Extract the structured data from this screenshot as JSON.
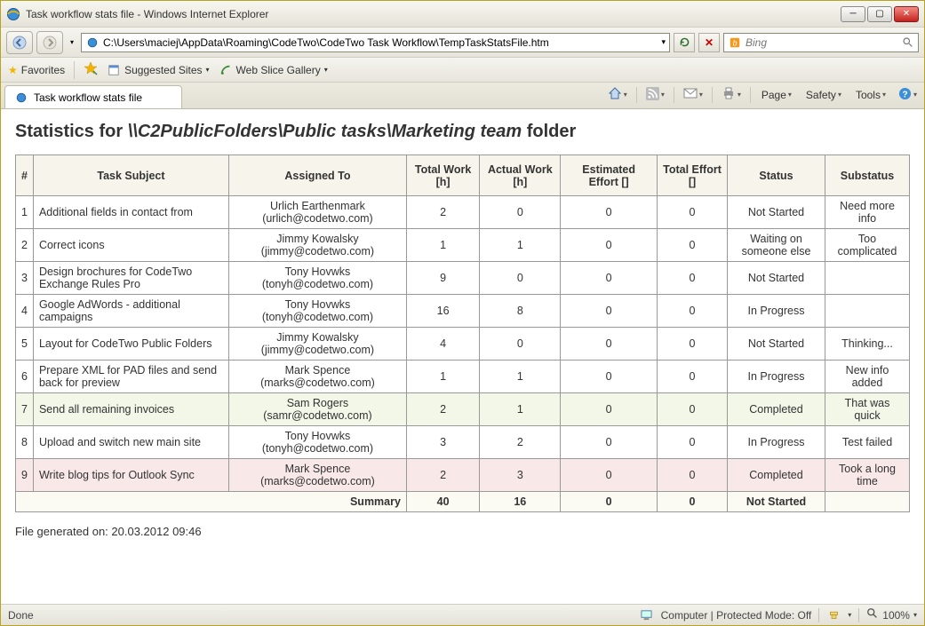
{
  "window": {
    "title": "Task workflow stats file - Windows Internet Explorer"
  },
  "nav": {
    "url": "C:\\Users\\maciej\\AppData\\Roaming\\CodeTwo\\CodeTwo Task Workflow\\TempTaskStatsFile.htm",
    "search_placeholder": "Bing"
  },
  "favorites": {
    "label": "Favorites",
    "suggested": "Suggested Sites",
    "webslice": "Web Slice Gallery"
  },
  "tab": {
    "label": "Task workflow stats file"
  },
  "toolbar": {
    "page": "Page",
    "safety": "Safety",
    "tools": "Tools"
  },
  "page": {
    "heading_prefix": "Statistics for ",
    "heading_path": "\\\\C2PublicFolders\\Public tasks\\Marketing team",
    "heading_suffix": " folder",
    "columns": [
      "#",
      "Task Subject",
      "Assigned To",
      "Total Work [h]",
      "Actual Work [h]",
      "Estimated Effort []",
      "Total Effort []",
      "Status",
      "Substatus"
    ],
    "rows": [
      {
        "n": "1",
        "subject": "Additional fields in contact from",
        "assigned_name": "Urlich Earthenmark",
        "assigned_email": "(urlich@codetwo.com)",
        "total_work": "2",
        "actual_work": "0",
        "est_effort": "0",
        "total_effort": "0",
        "status": "Not Started",
        "substatus": "Need more info",
        "cls": ""
      },
      {
        "n": "2",
        "subject": "Correct icons",
        "assigned_name": "Jimmy Kowalsky",
        "assigned_email": "(jimmy@codetwo.com)",
        "total_work": "1",
        "actual_work": "1",
        "est_effort": "0",
        "total_effort": "0",
        "status": "Waiting on someone else",
        "substatus": "Too complicated",
        "cls": ""
      },
      {
        "n": "3",
        "subject": "Design brochures for CodeTwo Exchange Rules Pro",
        "assigned_name": "Tony Hovwks",
        "assigned_email": "(tonyh@codetwo.com)",
        "total_work": "9",
        "actual_work": "0",
        "est_effort": "0",
        "total_effort": "0",
        "status": "Not Started",
        "substatus": "",
        "cls": ""
      },
      {
        "n": "4",
        "subject": "Google AdWords - additional campaigns",
        "assigned_name": "Tony Hovwks",
        "assigned_email": "(tonyh@codetwo.com)",
        "total_work": "16",
        "actual_work": "8",
        "est_effort": "0",
        "total_effort": "0",
        "status": "In Progress",
        "substatus": "",
        "cls": ""
      },
      {
        "n": "5",
        "subject": "Layout for CodeTwo Public Folders",
        "assigned_name": "Jimmy Kowalsky",
        "assigned_email": "(jimmy@codetwo.com)",
        "total_work": "4",
        "actual_work": "0",
        "est_effort": "0",
        "total_effort": "0",
        "status": "Not Started",
        "substatus": "Thinking...",
        "cls": ""
      },
      {
        "n": "6",
        "subject": "Prepare XML for PAD files and send back for preview",
        "assigned_name": "Mark Spence",
        "assigned_email": "(marks@codetwo.com)",
        "total_work": "1",
        "actual_work": "1",
        "est_effort": "0",
        "total_effort": "0",
        "status": "In Progress",
        "substatus": "New info added",
        "cls": ""
      },
      {
        "n": "7",
        "subject": "Send all remaining invoices",
        "assigned_name": "Sam Rogers (samr@codetwo.com)",
        "assigned_email": "",
        "total_work": "2",
        "actual_work": "1",
        "est_effort": "0",
        "total_effort": "0",
        "status": "Completed",
        "substatus": "That was quick",
        "cls": "row-green"
      },
      {
        "n": "8",
        "subject": "Upload and switch new main site",
        "assigned_name": "Tony Hovwks",
        "assigned_email": "(tonyh@codetwo.com)",
        "total_work": "3",
        "actual_work": "2",
        "est_effort": "0",
        "total_effort": "0",
        "status": "In Progress",
        "substatus": "Test failed",
        "cls": ""
      },
      {
        "n": "9",
        "subject": "Write blog tips for Outlook Sync",
        "assigned_name": "Mark Spence",
        "assigned_email": "(marks@codetwo.com)",
        "total_work": "2",
        "actual_work": "3",
        "est_effort": "0",
        "total_effort": "0",
        "status": "Completed",
        "substatus": "Took a long time",
        "cls": "row-pink"
      }
    ],
    "summary": {
      "label": "Summary",
      "total_work": "40",
      "actual_work": "16",
      "est_effort": "0",
      "total_effort": "0",
      "status": "Not Started"
    },
    "file_generated": "File generated on: 20.03.2012 09:46"
  },
  "statusbar": {
    "done": "Done",
    "mode": "Computer | Protected Mode: Off",
    "zoom": "100%"
  }
}
